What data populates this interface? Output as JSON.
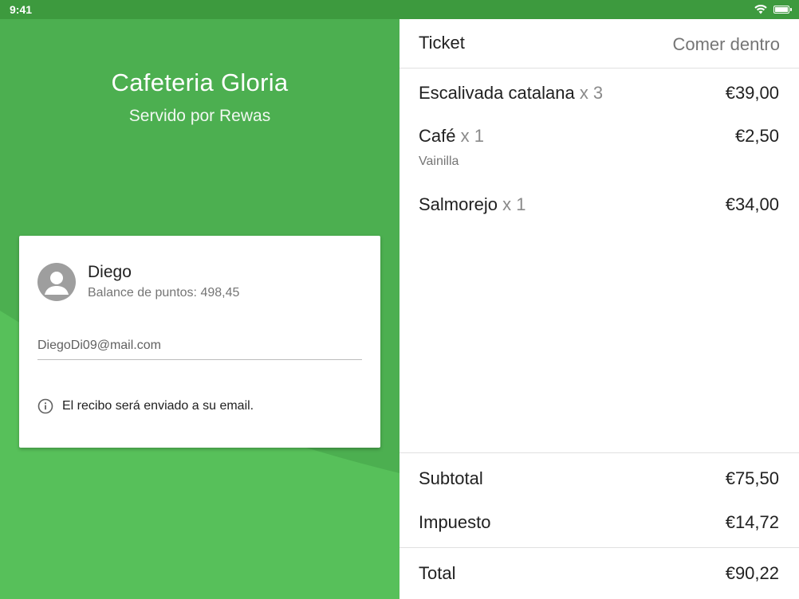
{
  "status_bar": {
    "time": "9:41",
    "wifi_icon": "wifi-icon",
    "battery_icon": "battery-icon"
  },
  "colors": {
    "brand_green": "#4caf50",
    "status_green": "#3d9a3e",
    "text_primary": "#212121",
    "text_secondary": "#757575"
  },
  "venue": {
    "name": "Cafeteria Gloria",
    "served_by": "Servido por Rewas"
  },
  "customer": {
    "avatar_icon": "account-circle-icon",
    "name": "Diego",
    "points_label": "Balance de puntos: 498,45",
    "email_value": "DiegoDi09@mail.com",
    "info_icon": "info-icon",
    "receipt_note": "El recibo será enviado a su email."
  },
  "ticket": {
    "title": "Ticket",
    "order_type": "Comer dentro",
    "items": [
      {
        "name": "Escalivada catalana",
        "qty": "x 3",
        "price": "€39,00",
        "note": ""
      },
      {
        "name": "Café",
        "qty": "x 1",
        "price": "€2,50",
        "note": "Vainilla"
      },
      {
        "name": "Salmorejo",
        "qty": "x 1",
        "price": "€34,00",
        "note": ""
      }
    ],
    "subtotal_label": "Subtotal",
    "subtotal_value": "€75,50",
    "tax_label": "Impuesto",
    "tax_value": "€14,72",
    "total_label": "Total",
    "total_value": "€90,22"
  }
}
